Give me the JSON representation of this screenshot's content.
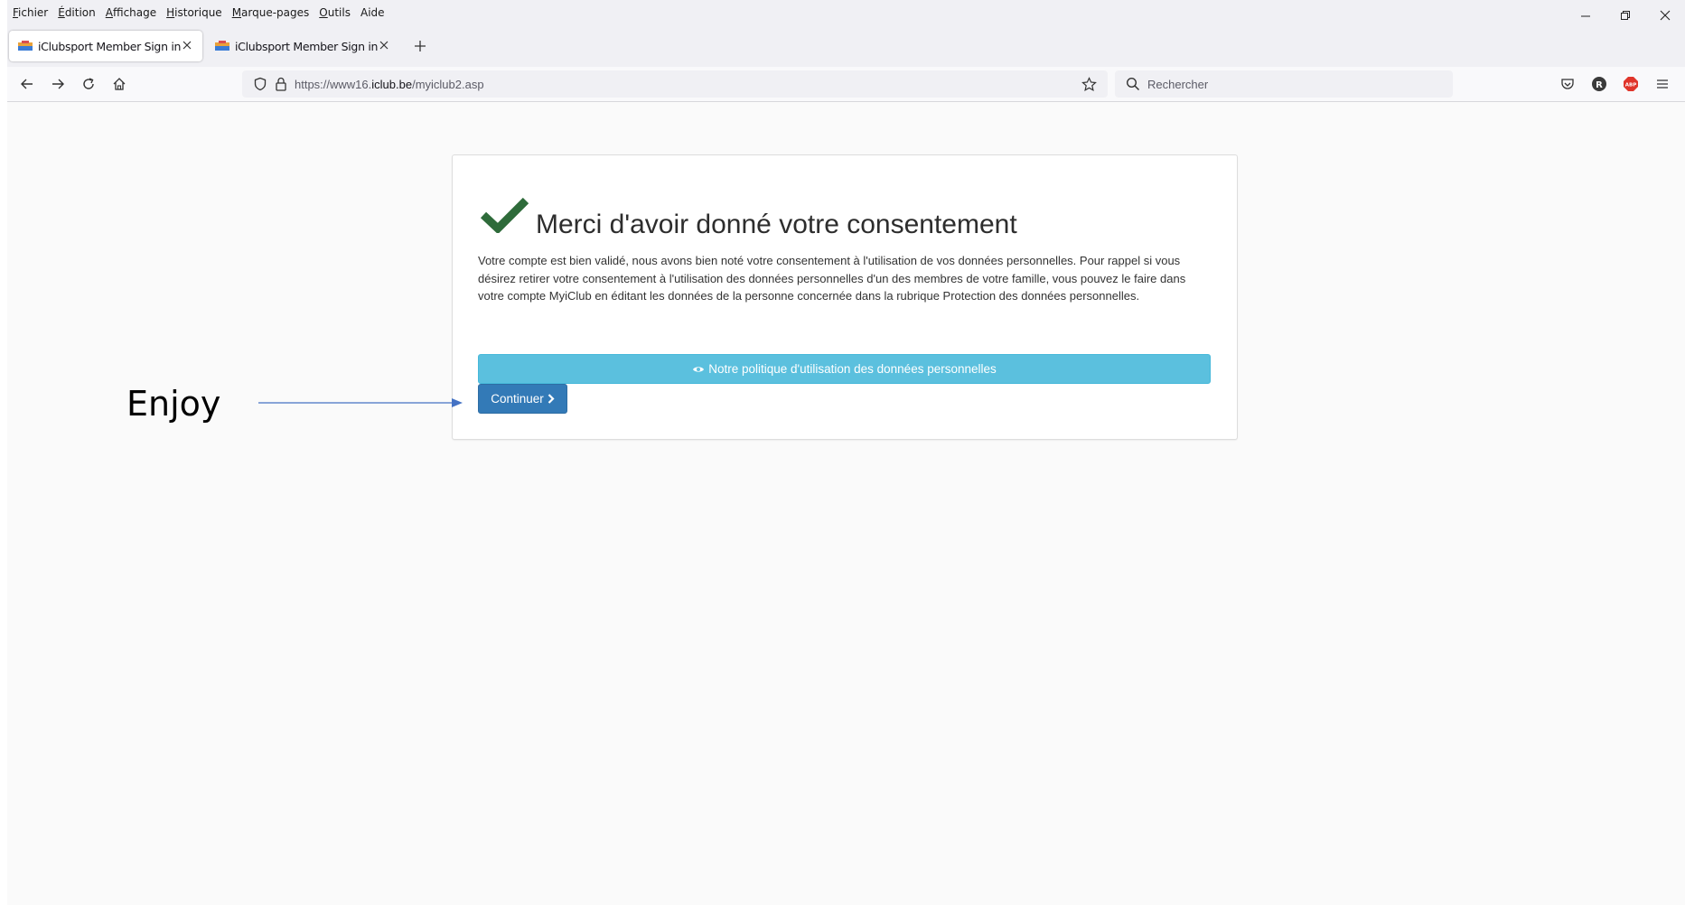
{
  "menubar": {
    "items": [
      {
        "first": "F",
        "rest": "ichier"
      },
      {
        "first": "É",
        "rest": "dition"
      },
      {
        "first": "A",
        "rest": "ffichage"
      },
      {
        "first": "H",
        "rest": "istorique"
      },
      {
        "first": "M",
        "rest": "arque-pages"
      },
      {
        "first": "O",
        "rest": "utils"
      },
      {
        "first": "A",
        "rest": "ide"
      }
    ]
  },
  "tabs": [
    {
      "title": "iClubsport Member Sign in"
    },
    {
      "title": "iClubsport Member Sign in"
    }
  ],
  "navbar": {
    "url_prefix": "https://www16.",
    "url_domain": "iclub.be",
    "url_path": "/myiclub2.asp",
    "search_placeholder": "Rechercher"
  },
  "page": {
    "title": "Merci d'avoir donné votre consentement",
    "body": "Votre compte est bien validé, nous avons bien noté votre consentement à l'utilisation de vos données personnelles. Pour rappel si vous désirez retirer votre consentement à l'utilisation des données personnelles d'un des membres de votre famille, vous pouvez le faire dans votre compte MyiClub en éditant les données de la personne concernée dans la rubrique Protection des données personnelles.",
    "policy_button": "Notre politique d'utilisation des données personnelles",
    "continue_button": "Continuer"
  },
  "annotation": {
    "label": "Enjoy"
  },
  "colors": {
    "info": "#5bc0de",
    "primary": "#337ab7",
    "check": "#2e6b3a"
  }
}
